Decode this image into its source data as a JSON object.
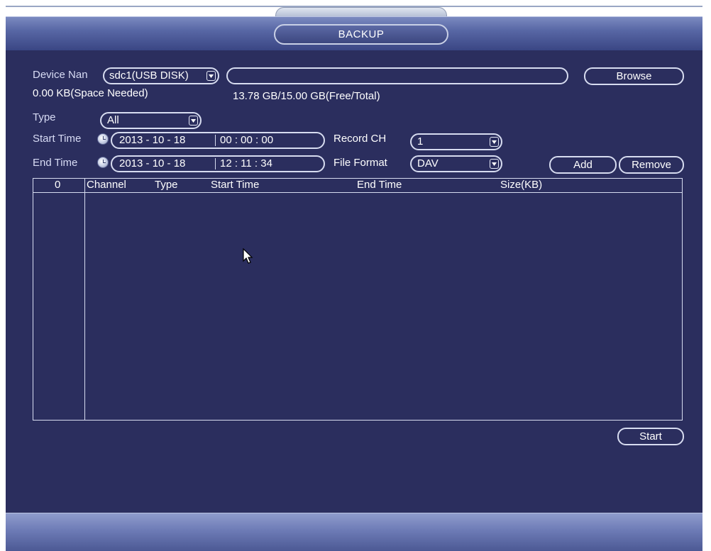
{
  "window": {
    "title": "BACKUP"
  },
  "device": {
    "label": "Device Nan",
    "value": "sdc1(USB DISK)",
    "path_value": "",
    "browse_label": "Browse"
  },
  "space": {
    "needed": "0.00 KB(Space Needed)",
    "free_total": "13.78 GB/15.00 GB(Free/Total)"
  },
  "type": {
    "label": "Type",
    "value": "All"
  },
  "start_time": {
    "label": "Start Time",
    "date": "2013 - 10 - 18",
    "time": "00 : 00 : 00"
  },
  "end_time": {
    "label": "End Time",
    "date": "2013 - 10 - 18",
    "time": "12 : 11 : 34"
  },
  "record_ch": {
    "label": "Record CH",
    "value": "1"
  },
  "file_format": {
    "label": "File Format",
    "value": "DAV"
  },
  "buttons": {
    "add": "Add",
    "remove": "Remove",
    "start": "Start"
  },
  "table": {
    "columns": [
      "0",
      "Channel",
      "Type",
      "Start Time",
      "End Time",
      "Size(KB)"
    ],
    "rows": []
  },
  "colors": {
    "background": "#2b2e5e",
    "titlebar": "#5867a5",
    "border": "#d7dcf0"
  }
}
